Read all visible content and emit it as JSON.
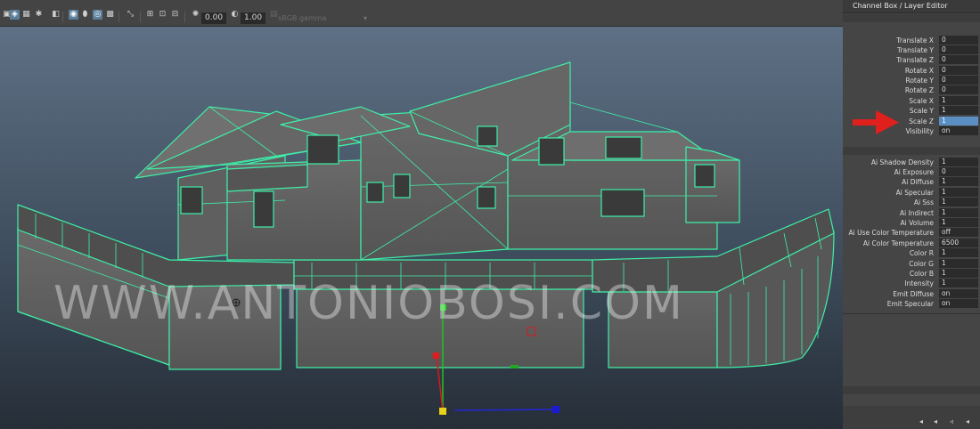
{
  "toolbar": {
    "exposure_value": "0.00",
    "gamma_value": "1.00",
    "color_space": "sRGB gamma"
  },
  "viewport": {
    "watermark": "WWW.ANTONIOBOSI.COM"
  },
  "channel_box": {
    "title": "Channel Box / Layer Editor",
    "transform_attrs": [
      {
        "label": "Translate X",
        "value": "0"
      },
      {
        "label": "Translate Y",
        "value": "0"
      },
      {
        "label": "Translate Z",
        "value": "0"
      },
      {
        "label": "Rotate X",
        "value": "0"
      },
      {
        "label": "Rotate Y",
        "value": "0"
      },
      {
        "label": "Rotate Z",
        "value": "0"
      },
      {
        "label": "Scale X",
        "value": "1"
      },
      {
        "label": "Scale Y",
        "value": "1"
      },
      {
        "label": "Scale Z",
        "value": "1"
      },
      {
        "label": "Visibility",
        "value": "on"
      }
    ],
    "shape_attrs": [
      {
        "label": "Ai Shadow Density",
        "value": "1"
      },
      {
        "label": "Ai Exposure",
        "value": "0"
      },
      {
        "label": "Ai Diffuse",
        "value": "1"
      },
      {
        "label": "Ai Specular",
        "value": "1"
      },
      {
        "label": "Ai Sss",
        "value": "1"
      },
      {
        "label": "Ai Indirect",
        "value": "1"
      },
      {
        "label": "Ai Volume",
        "value": "1"
      },
      {
        "label": "Ai Use Color Temperature",
        "value": "off"
      },
      {
        "label": "Ai Color Temperature",
        "value": "6500"
      },
      {
        "label": "Color R",
        "value": "1"
      },
      {
        "label": "Color G",
        "value": "1"
      },
      {
        "label": "Color B",
        "value": "1"
      },
      {
        "label": "Intensity",
        "value": "1"
      },
      {
        "label": "Emit Diffuse",
        "value": "on"
      },
      {
        "label": "Emit Specular",
        "value": "on"
      }
    ]
  },
  "colors": {
    "wireframe": "#3ef0a8",
    "selection": "#5a8fc4",
    "arrow": "#e0201c"
  }
}
